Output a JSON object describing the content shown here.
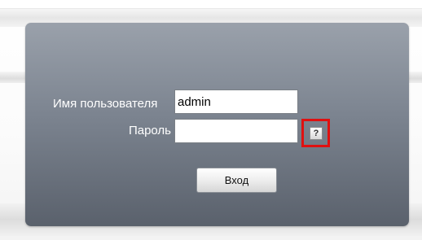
{
  "login_form": {
    "username_label": "Имя пользователя",
    "username_value": "admin",
    "password_label": "Пароль",
    "password_value": "",
    "help_button_label": "?",
    "submit_label": "Вход"
  },
  "colors": {
    "panel_top": "#9aa1ab",
    "panel_bottom": "#5a616c",
    "highlight_frame": "#e01010",
    "label_text": "#ffffff"
  }
}
